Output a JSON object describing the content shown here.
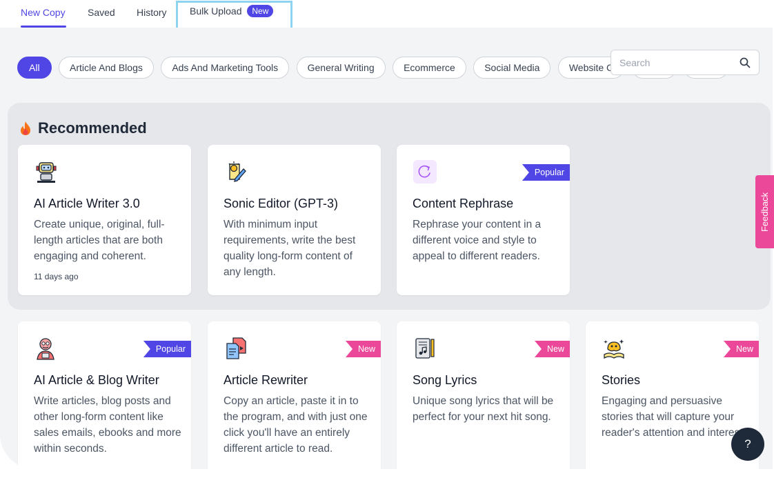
{
  "tabs": {
    "new_copy": "New Copy",
    "saved": "Saved",
    "history": "History",
    "bulk_upload": "Bulk Upload",
    "bulk_badge": "New"
  },
  "filters": {
    "items": [
      "All",
      "Article And Blogs",
      "Ads And Marketing Tools",
      "General Writing",
      "Ecommerce",
      "Social Media",
      "Website C"
    ]
  },
  "search": {
    "placeholder": "Search"
  },
  "recommended": {
    "title": "Recommended",
    "cards": [
      {
        "title": "AI Article Writer 3.0",
        "description": "Create unique, original, full-length articles that are both engaging and coherent.",
        "meta": "11 days ago",
        "icon": "robot-icon",
        "ribbon": ""
      },
      {
        "title": "Sonic Editor (GPT-3)",
        "description": "With minimum input requirements, write the best quality long-form content of any length.",
        "icon": "lightbulb-pencil-icon",
        "ribbon": ""
      },
      {
        "title": "Content Rephrase",
        "description": "Rephrase your content in a different voice and style to appeal to different readers.",
        "icon": "refresh-icon",
        "ribbon": "Popular"
      }
    ]
  },
  "tools": [
    {
      "title": "AI Article & Blog Writer",
      "description": "Write articles, blog posts and other long-form content like sales emails, ebooks and more within seconds.",
      "icon": "writer-avatar-icon",
      "ribbon": "Popular"
    },
    {
      "title": "Article Rewriter",
      "description": "Copy an article, paste it in to the program, and with just one click you'll have an entirely different article to read.",
      "icon": "document-rewrite-icon",
      "ribbon": "New"
    },
    {
      "title": "Song Lyrics",
      "description": "Unique song lyrics that will be perfect for your next hit song.",
      "icon": "music-notes-icon",
      "ribbon": "New"
    },
    {
      "title": "Stories",
      "description": "Engaging and persuasive stories that will capture your reader's attention and interest.",
      "icon": "storybook-icon",
      "ribbon": "New"
    }
  ],
  "feedback": "Feedback",
  "help": "?",
  "colors": {
    "accent": "#4f46e5",
    "new": "#ec4899",
    "panel": "#f3f4f6"
  }
}
